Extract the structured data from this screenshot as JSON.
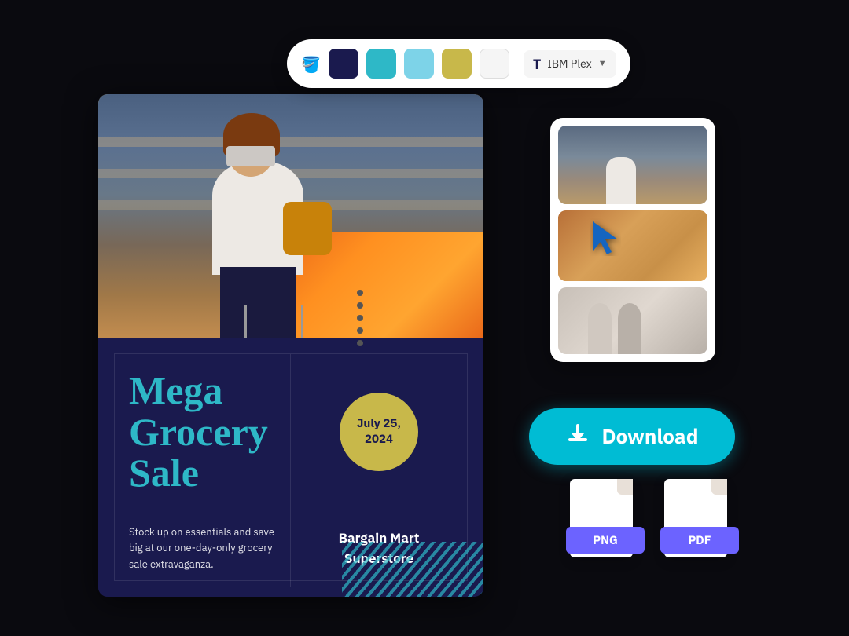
{
  "toolbar": {
    "font_name": "IBM Plex",
    "font_dropdown_label": "▼",
    "colors": [
      {
        "id": "dark-navy",
        "hex": "#1a1a4e"
      },
      {
        "id": "teal",
        "hex": "#2eb8c7"
      },
      {
        "id": "light-blue",
        "hex": "#7dd3e8"
      },
      {
        "id": "gold",
        "hex": "#c8b84a"
      },
      {
        "id": "white",
        "hex": "#f5f5f5"
      }
    ]
  },
  "poster": {
    "title_line1": "Mega",
    "title_line2": "Grocery",
    "title_line3": "Sale",
    "date_label": "July 25,\n2024",
    "description": "Stock up on essentials and save big at our one-day-only grocery sale extravaganza.",
    "store_name": "Bargain Mart\nSuperstore",
    "background_color": "#1a1a4e",
    "title_color": "#2eb8c7",
    "date_circle_color": "#c8b84a"
  },
  "image_selector": {
    "images": [
      {
        "id": "img-top",
        "alt": "Grocery store shopper top"
      },
      {
        "id": "img-middle",
        "alt": "Grocery store produce"
      },
      {
        "id": "img-bottom",
        "alt": "Store staff"
      }
    ]
  },
  "download_button": {
    "label": "Download",
    "bg_color": "#00bcd4"
  },
  "file_formats": [
    {
      "label": "PNG",
      "badge_color": "#6c63ff"
    },
    {
      "label": "PDF",
      "badge_color": "#6c63ff"
    }
  ]
}
